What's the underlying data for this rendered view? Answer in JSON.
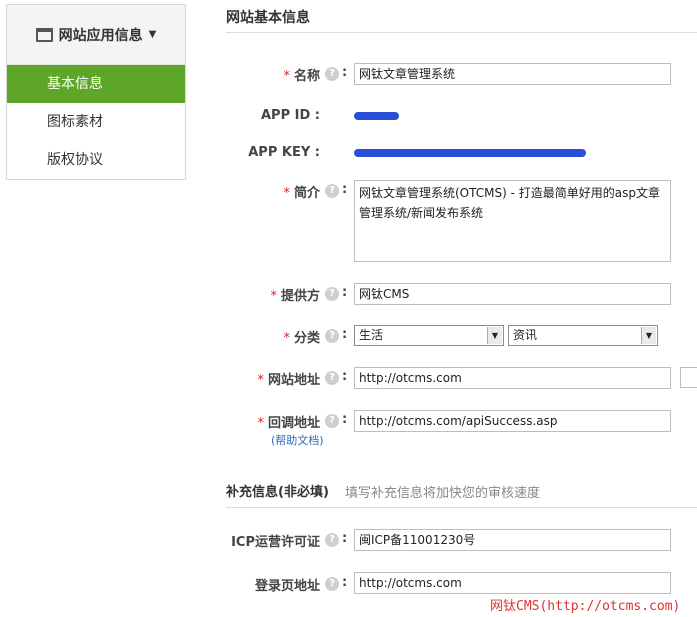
{
  "sidebar": {
    "header_label": "网站应用信息",
    "items": [
      {
        "label": "基本信息",
        "active": true
      },
      {
        "label": "图标素材",
        "active": false
      },
      {
        "label": "版权协议",
        "active": false
      }
    ]
  },
  "main": {
    "section_title": "网站基本信息",
    "fields": {
      "name": {
        "label": "名称",
        "value": "网钛文章管理系统"
      },
      "app_id": {
        "label": "APP ID"
      },
      "app_key": {
        "label": "APP KEY"
      },
      "intro": {
        "label": "简介",
        "value": "网钛文章管理系统(OTCMS) - 打造最简单好用的asp文章管理系统/新闻发布系统"
      },
      "provider": {
        "label": "提供方",
        "value": "网钛CMS"
      },
      "category": {
        "label": "分类",
        "primary": "生活",
        "secondary": "资讯"
      },
      "site_url": {
        "label": "网站地址",
        "value": "http://otcms.com"
      },
      "callback_url": {
        "label": "回调地址",
        "value": "http://otcms.com/apiSuccess.asp",
        "help_link": "(帮助文档)"
      }
    },
    "supplement": {
      "title": "补充信息(非必填)",
      "note": "填写补充信息将加快您的审核速度",
      "icp": {
        "label": "ICP运营许可证",
        "value": "闽ICP备11001230号"
      },
      "login_url": {
        "label": "登录页地址",
        "value": "http://otcms.com"
      }
    }
  },
  "required_mark": "*",
  "help_glyph": "?",
  "colon": ":",
  "watermark": "网钛CMS(http://otcms.com)",
  "colors": {
    "active_green": "#5ea628",
    "required_red": "#e02020",
    "link_blue": "#2a6ab8",
    "redaction_blue": "#2b4fd4"
  }
}
